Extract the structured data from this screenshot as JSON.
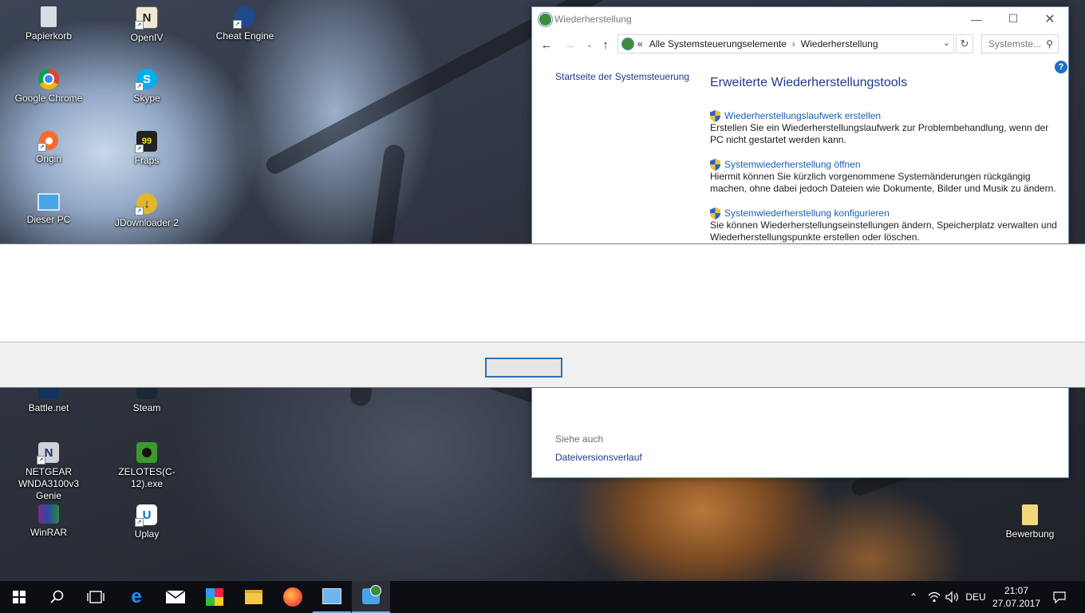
{
  "desktop": {
    "icons": [
      {
        "label": "Papierkorb",
        "icon": "recycle-bin-icon"
      },
      {
        "label": "OpenIV",
        "icon": "openiv-icon"
      },
      {
        "label": "Cheat Engine",
        "icon": "cheat-engine-icon"
      },
      {
        "label": "Google Chrome",
        "icon": "chrome-icon"
      },
      {
        "label": "Skype",
        "icon": "skype-icon"
      },
      {
        "label": "Origin",
        "icon": "origin-icon"
      },
      {
        "label": "Fraps",
        "icon": "fraps-icon"
      },
      {
        "label": "Dieser PC",
        "icon": "computer-icon"
      },
      {
        "label": "JDownloader 2",
        "icon": "jdownloader-icon"
      },
      {
        "label": "Battle.net",
        "icon": "battlenet-icon"
      },
      {
        "label": "Steam",
        "icon": "steam-icon"
      },
      {
        "label": "NETGEAR WNDA3100v3 Genie",
        "icon": "netgear-icon"
      },
      {
        "label": "ZELOTES(C-12).exe",
        "icon": "zelotes-icon"
      },
      {
        "label": "WinRAR",
        "icon": "winrar-icon"
      },
      {
        "label": "Uplay",
        "icon": "uplay-icon"
      },
      {
        "label": "Bewerbung",
        "icon": "folder-icon"
      }
    ]
  },
  "window": {
    "title": "Wiederherstellung",
    "address": {
      "prefix": "«",
      "crumb1": "Alle Systemsteuerungselemente",
      "separator": "›",
      "crumb2": "Wiederherstellung"
    },
    "search_placeholder": "Systemste...",
    "help": "?",
    "left_link": "Startseite der Systemsteuerung",
    "heading": "Erweiterte Wiederherstellungstools",
    "items": [
      {
        "link": "Wiederherstellungslaufwerk erstellen",
        "desc": "Erstellen Sie ein Wiederherstellungslaufwerk zur Problembehandlung, wenn der PC nicht gestartet werden kann."
      },
      {
        "link": "Systemwiederherstellung öffnen",
        "desc": "Hiermit können Sie kürzlich vorgenommene Systemänderungen rückgängig machen, ohne dabei jedoch Dateien wie Dokumente, Bilder und Musik zu ändern."
      },
      {
        "link": "Systemwiederherstellung konfigurieren",
        "desc": "Sie können Wiederherstellungseinstellungen ändern, Speicherplatz verwalten und Wiederherstellungspunkte erstellen oder löschen."
      }
    ],
    "see_also": "Siehe auch",
    "file_history": "Dateiversionsverlauf"
  },
  "dialog": {
    "button_label": ""
  },
  "taskbar": {
    "apps": [
      "start-icon",
      "search-icon",
      "task-view-icon",
      "edge-icon",
      "mail-icon",
      "app-icon",
      "file-explorer-icon",
      "firefox-icon",
      "control-panel-icon",
      "recovery-icon"
    ],
    "language": "DEU",
    "time": "21:07",
    "date": "27.07.2017"
  },
  "colors": {
    "link": "#1a5fb4",
    "heading": "#1e3a8a",
    "taskbar": "#0c0e13",
    "accent": "#2f6fb5"
  }
}
